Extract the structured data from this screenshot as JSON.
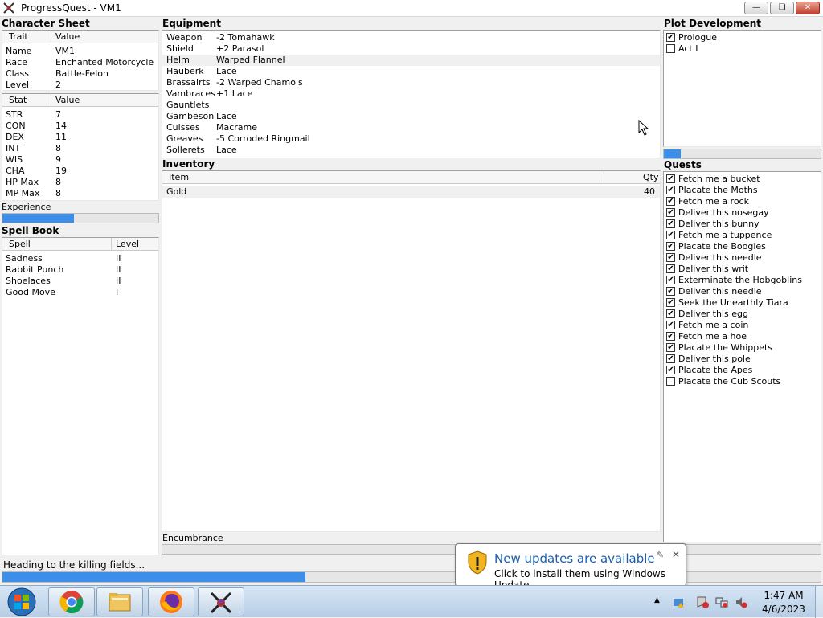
{
  "window": {
    "title": "ProgressQuest - VM1"
  },
  "character_sheet": {
    "label": "Character Sheet",
    "col_trait": "Trait",
    "col_value": "Value",
    "traits": [
      {
        "name": "Name",
        "value": "VM1"
      },
      {
        "name": "Race",
        "value": "Enchanted Motorcycle"
      },
      {
        "name": "Class",
        "value": "Battle-Felon"
      },
      {
        "name": "Level",
        "value": "2"
      }
    ],
    "col_stat": "Stat",
    "col_stat_value": "Value",
    "stats": [
      {
        "name": "STR",
        "value": "7"
      },
      {
        "name": "CON",
        "value": "14"
      },
      {
        "name": "DEX",
        "value": "11"
      },
      {
        "name": "INT",
        "value": "8"
      },
      {
        "name": "WIS",
        "value": "9"
      },
      {
        "name": "CHA",
        "value": "19"
      },
      {
        "name": "HP Max",
        "value": "8"
      },
      {
        "name": "MP Max",
        "value": "8"
      }
    ],
    "experience_label": "Experience",
    "experience_progress": 0.46
  },
  "spell_book": {
    "label": "Spell Book",
    "col_spell": "Spell",
    "col_level": "Level",
    "spells": [
      {
        "name": "Sadness",
        "level": "II"
      },
      {
        "name": "Rabbit Punch",
        "level": "II"
      },
      {
        "name": "Shoelaces",
        "level": "II"
      },
      {
        "name": "Good Move",
        "level": "I"
      }
    ]
  },
  "equipment": {
    "label": "Equipment",
    "items": [
      {
        "slot": "Weapon",
        "value": "-2 Tomahawk"
      },
      {
        "slot": "Shield",
        "value": "+2 Parasol"
      },
      {
        "slot": "Helm",
        "value": "Warped Flannel"
      },
      {
        "slot": "Hauberk",
        "value": "Lace"
      },
      {
        "slot": "Brassairts",
        "value": "-2 Warped Chamois"
      },
      {
        "slot": "Vambraces",
        "value": "+1 Lace"
      },
      {
        "slot": "Gauntlets",
        "value": ""
      },
      {
        "slot": "Gambeson",
        "value": "Lace"
      },
      {
        "slot": "Cuisses",
        "value": "Macrame"
      },
      {
        "slot": "Greaves",
        "value": "-5 Corroded Ringmail"
      },
      {
        "slot": "Sollerets",
        "value": "Lace"
      }
    ]
  },
  "inventory": {
    "label": "Inventory",
    "col_item": "Item",
    "col_qty": "Qty",
    "rows": [
      {
        "item": "Gold",
        "qty": "40"
      }
    ],
    "encumbrance_label": "Encumbrance"
  },
  "plot": {
    "label": "Plot Development",
    "acts": [
      {
        "name": "Prologue",
        "checked": true
      },
      {
        "name": "Act I",
        "checked": false
      }
    ],
    "progress": 0.11
  },
  "quests": {
    "label": "Quests",
    "items": [
      {
        "name": "Fetch me a bucket",
        "checked": true
      },
      {
        "name": "Placate the Moths",
        "checked": true
      },
      {
        "name": "Fetch me a rock",
        "checked": true
      },
      {
        "name": "Deliver this nosegay",
        "checked": true
      },
      {
        "name": "Deliver this bunny",
        "checked": true
      },
      {
        "name": "Fetch me a tuppence",
        "checked": true
      },
      {
        "name": "Placate the Boogies",
        "checked": true
      },
      {
        "name": "Deliver this needle",
        "checked": true
      },
      {
        "name": "Deliver this writ",
        "checked": true
      },
      {
        "name": "Exterminate the Hobgoblins",
        "checked": true
      },
      {
        "name": "Deliver this needle",
        "checked": true
      },
      {
        "name": "Seek the Unearthly Tiara",
        "checked": true
      },
      {
        "name": "Deliver this egg",
        "checked": true
      },
      {
        "name": "Fetch me a coin",
        "checked": true
      },
      {
        "name": "Fetch me a hoe",
        "checked": true
      },
      {
        "name": "Placate the Whippets",
        "checked": true
      },
      {
        "name": "Deliver this pole",
        "checked": true
      },
      {
        "name": "Placate the Apes",
        "checked": true
      },
      {
        "name": "Placate the Cub Scouts",
        "checked": false
      }
    ]
  },
  "status": {
    "text": "Heading to the killing fields...",
    "progress": 0.37
  },
  "notification": {
    "title": "New updates are available",
    "body": "Click to install them using Windows Update."
  },
  "taskbar": {
    "time": "1:47 AM",
    "date": "4/6/2023"
  },
  "colors": {
    "progress": "#3d8ee8",
    "notify_title": "#1c5dab"
  }
}
